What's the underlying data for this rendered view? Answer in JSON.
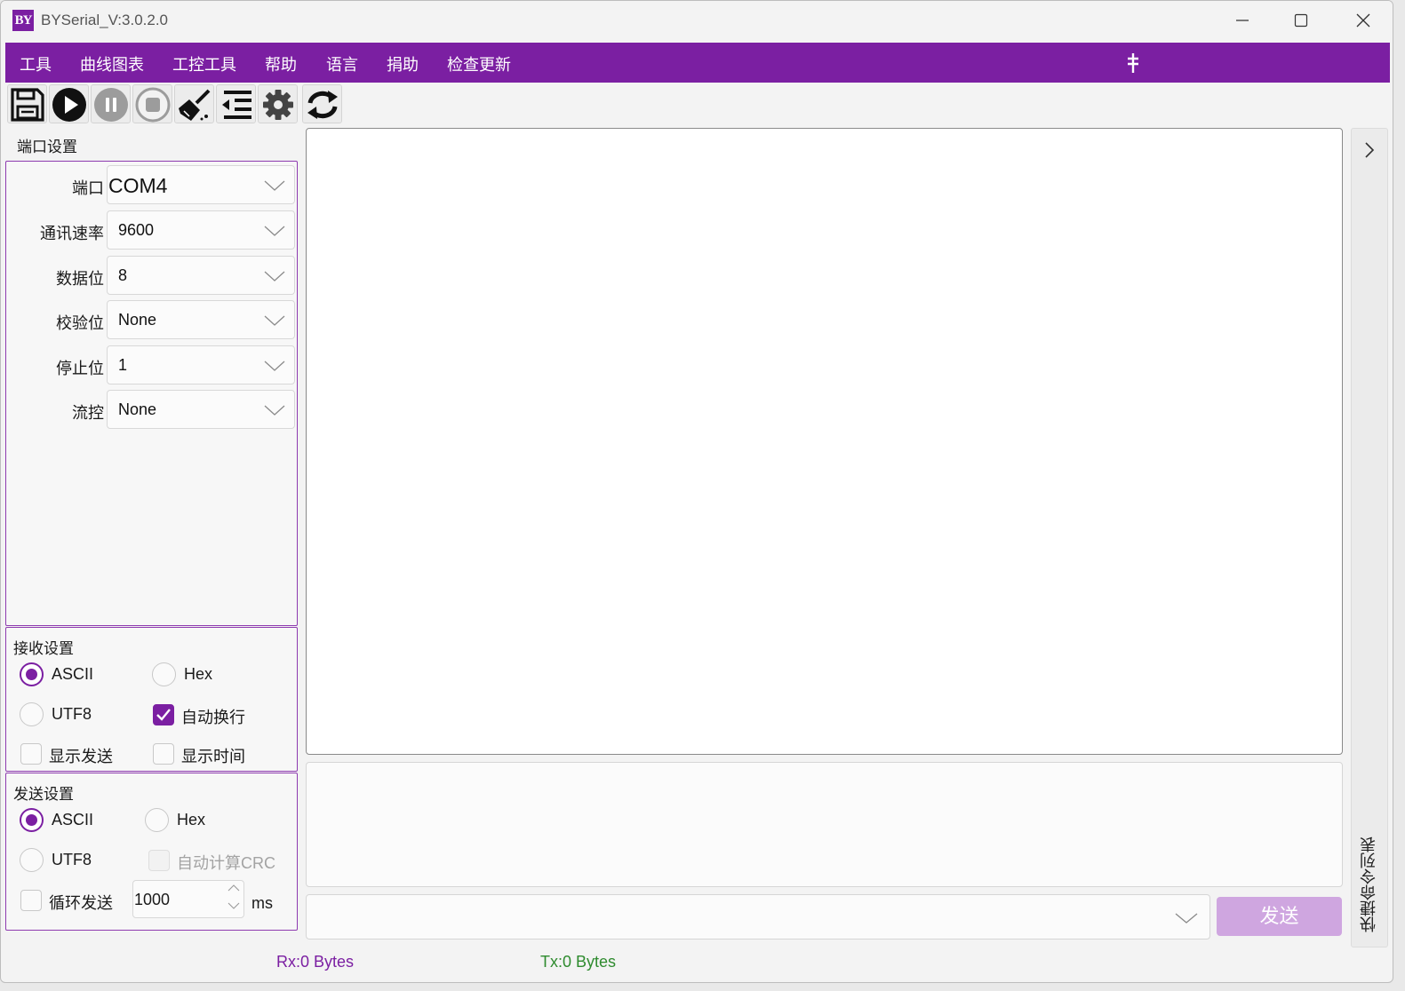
{
  "window": {
    "logo_text": "BY",
    "title": "BYSerial_V:3.0.2.0"
  },
  "menu": [
    "工具",
    "曲线图表",
    "工控工具",
    "帮助",
    "语言",
    "捐助",
    "检查更新"
  ],
  "toolbar": {
    "icons": [
      "save-icon",
      "play-icon",
      "pause-icon",
      "stop-icon",
      "clear-icon",
      "indent-icon",
      "gear-icon",
      "refresh-icon"
    ]
  },
  "port_settings": {
    "title": "端口设置",
    "fields": [
      {
        "label": "端口",
        "value": "COM4"
      },
      {
        "label": "通讯速率",
        "value": "9600"
      },
      {
        "label": "数据位",
        "value": "8"
      },
      {
        "label": "校验位",
        "value": "None"
      },
      {
        "label": "停止位",
        "value": "1"
      },
      {
        "label": "流控",
        "value": "None"
      }
    ]
  },
  "receive_settings": {
    "title": "接收设置",
    "ascii": "ASCII",
    "hex": "Hex",
    "utf8": "UTF8",
    "auto_wrap": "自动换行",
    "show_send": "显示发送",
    "show_time": "显示时间",
    "selected": "ASCII",
    "auto_wrap_checked": true
  },
  "send_settings": {
    "title": "发送设置",
    "ascii": "ASCII",
    "hex": "Hex",
    "utf8": "UTF8",
    "auto_crc": "自动计算CRC",
    "loop_send": "循环发送",
    "interval": "1000",
    "unit": "ms",
    "selected": "ASCII"
  },
  "send_button": "发送",
  "side_panel": {
    "label": "快捷命令列表"
  },
  "status": {
    "rx": "Rx:0 Bytes",
    "tx": "Tx:0 Bytes"
  },
  "colors": {
    "accent": "#7b1fa2",
    "rx": "#7b1fa2",
    "tx": "#2e8b2e"
  }
}
